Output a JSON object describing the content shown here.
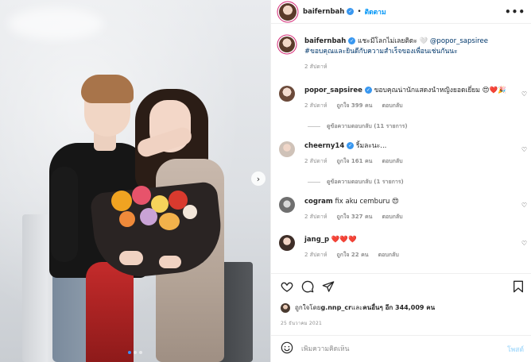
{
  "photo": {
    "next_arrow": "›",
    "dot_count": 3,
    "active_dot": 0
  },
  "header": {
    "username": "baifernbah",
    "verified_mark": "✓",
    "separator": "•",
    "follow_label": "ติดตาม",
    "more_label": "•••"
  },
  "caption": {
    "username": "baifernbah",
    "text": " แชะมีโลกไม่เลยติดะ 🤍 ",
    "mention": "@popor_sapsiree",
    "hashtag": " #ขอบคุณและยินดีกับความสำเร็จของเพื่อนเช่นกันนะ",
    "time": "2 สัปดาห์"
  },
  "comments": [
    {
      "username": "popor_sapsiree",
      "verified": true,
      "text": " ขอบคุณน่านักแสดงนำหญิงยอดเยี่ยม 😍❤️🎉",
      "time": "2 สัปดาห์",
      "likes": "ถูกใจ 399 คน",
      "reply": "ตอบกลับ",
      "view_replies": "ดูข้อความตอบกลับ (11 รายการ)"
    },
    {
      "username": "cheerny14",
      "verified": true,
      "text": " ริ้มละนะ...",
      "time": "2 สัปดาห์",
      "likes": "ถูกใจ 161 คน",
      "reply": "ตอบกลับ",
      "view_replies": "ดูข้อความตอบกลับ (1 รายการ)"
    },
    {
      "username": "cogram",
      "verified": false,
      "text": " fix aku cemburu 😍",
      "time": "2 สัปดาห์",
      "likes": "ถูกใจ 327 คน",
      "reply": "ตอบกลับ",
      "view_replies": ""
    },
    {
      "username": "jang_p",
      "verified": false,
      "text": " ❤️❤️❤️",
      "time": "2 สัปดาห์",
      "likes": "ถูกใจ 22 คน",
      "reply": "ตอบกลับ",
      "view_replies": ""
    }
  ],
  "actions": {
    "icons": [
      "heart-icon",
      "comment-icon",
      "share-icon",
      "bookmark-icon"
    ],
    "liked_by_prefix": "ถูกใจโดย ",
    "liked_by_user": "g.nnp_cr",
    "liked_by_mid": " และ ",
    "liked_by_others": "คนอื่นๆ อีก 344,009 คน",
    "date": "25 ธันวาคม 2021"
  },
  "add_comment": {
    "placeholder": "เพิ่มความคิดเห็น",
    "post_label": "โพสต์"
  },
  "colors": {
    "accent": "#0095f6",
    "verified": "#3897f0",
    "muted": "#8e8e8e",
    "post_disabled": "#b2dffc"
  }
}
